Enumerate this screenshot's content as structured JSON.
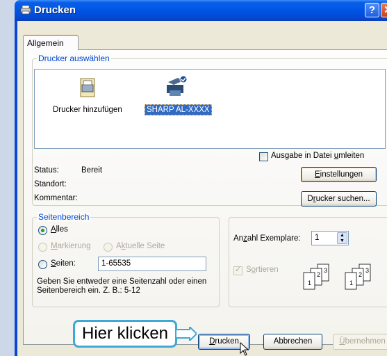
{
  "window": {
    "title": "Drucken",
    "help": "?",
    "close": "✕"
  },
  "tabs": [
    "Allgemein"
  ],
  "printer_group": {
    "legend": "Drucker auswählen",
    "printers": [
      {
        "name": "Drucker hinzufügen",
        "icon": "add-printer-icon",
        "selected": false
      },
      {
        "name": "SHARP AL-XXXX",
        "icon": "printer-icon",
        "selected": true
      }
    ],
    "print_to_file": "Ausgabe in Datei umleiten",
    "status_label": "Status:",
    "status_value": "Bereit",
    "location_label": "Standort:",
    "location_value": "",
    "comment_label": "Kommentar:",
    "comment_value": "",
    "settings_button": "Einstellungen",
    "find_printer_button": "Drucker suchen..."
  },
  "page_range": {
    "legend": "Seitenbereich",
    "all": "Alles",
    "selection": "Markierung",
    "current_page": "Aktuelle Seite",
    "pages": "Seiten:",
    "pages_value": "1-65535",
    "hint": "Geben Sie entweder eine Seitenzahl oder einen Seitenbereich ein. Z. B.: 5-12"
  },
  "copies": {
    "label": "Anzahl Exemplare:",
    "value": "1",
    "collate": "Sortieren"
  },
  "buttons": {
    "print": "Drucken",
    "cancel": "Abbrechen",
    "apply": "Übernehmen"
  },
  "callout": "Hier klicken",
  "colors": {
    "titlebar": "#0055e5",
    "legend": "#0046d5",
    "selection": "#316ac5",
    "callout_border": "#3ea8d6"
  }
}
